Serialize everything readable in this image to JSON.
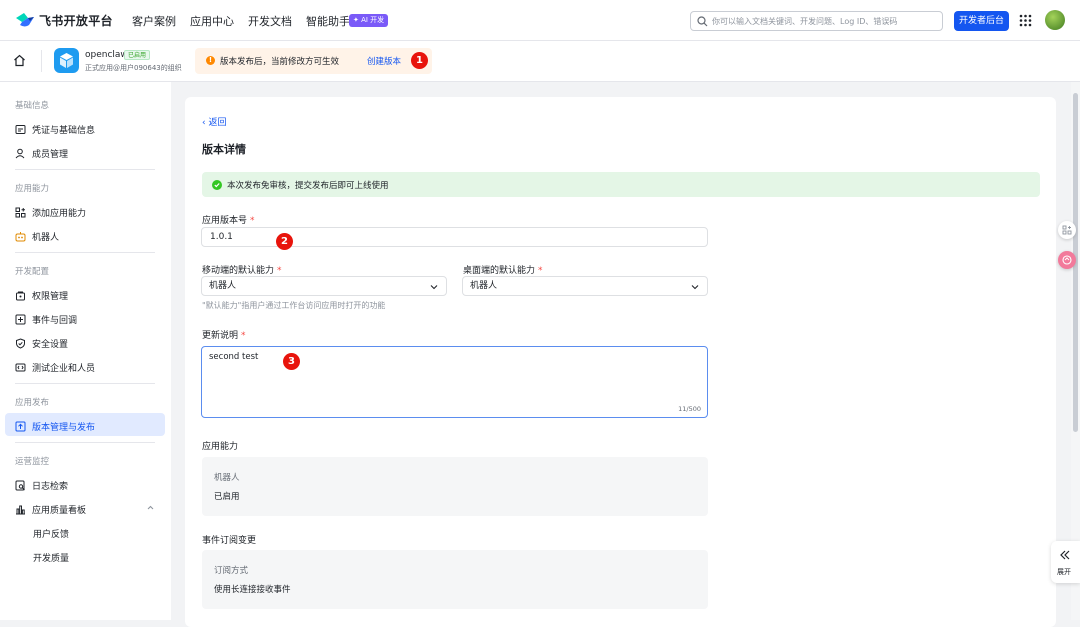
{
  "topnav": {
    "brand": "飞书开放平台",
    "links": [
      "客户案例",
      "应用中心",
      "开发文档",
      "智能助手"
    ],
    "ai_badge": "✦ AI 开发",
    "search_placeholder": "你可以输入文档关键词、开发问题、Log ID、错误码",
    "dev_console_button": "开发者后台"
  },
  "appbar": {
    "app_name": "openclaw",
    "app_status": "已启用",
    "app_org": "正式应用@用户090643的组织",
    "notice_text": "版本发布后，当前修改方可生效",
    "notice_link": "创建版本",
    "notice_icon": "!"
  },
  "sidebar": {
    "groups": [
      {
        "title": "基础信息",
        "items": [
          "凭证与基础信息",
          "成员管理"
        ]
      },
      {
        "title": "应用能力",
        "items": [
          "添加应用能力",
          "机器人"
        ]
      },
      {
        "title": "开发配置",
        "items": [
          "权限管理",
          "事件与回调",
          "安全设置",
          "测试企业和人员"
        ]
      },
      {
        "title": "应用发布",
        "items": [
          "版本管理与发布"
        ]
      },
      {
        "title": "运营监控",
        "items": [
          "日志检索",
          "应用质量看板"
        ],
        "subitems": [
          "用户反馈",
          "开发质量"
        ]
      }
    ],
    "active_item": "版本管理与发布"
  },
  "main": {
    "back_link": "返回",
    "page_title": "版本详情",
    "success_banner": "本次发布免审核，提交发布后即可上线使用",
    "version_label": "应用版本号",
    "version_value": "1.0.1",
    "mobile_default_label": "移动端的默认能力",
    "mobile_default_value": "机器人",
    "desktop_default_label": "桌面端的默认能力",
    "desktop_default_value": "机器人",
    "default_hint": "\"默认能力\"指用户通过工作台访问应用时打开的功能",
    "notes_label": "更新说明",
    "notes_value": "second test",
    "notes_counter": "11/500",
    "required_mark": "*",
    "capabilities_title": "应用能力",
    "capabilities_key": "机器人",
    "capabilities_value": "已启用",
    "events_title": "事件订阅变更",
    "events_key": "订阅方式",
    "events_value": "使用长连接接收事件"
  },
  "annotations": [
    "1",
    "2",
    "3"
  ],
  "float": {
    "expand_label": "展开"
  }
}
